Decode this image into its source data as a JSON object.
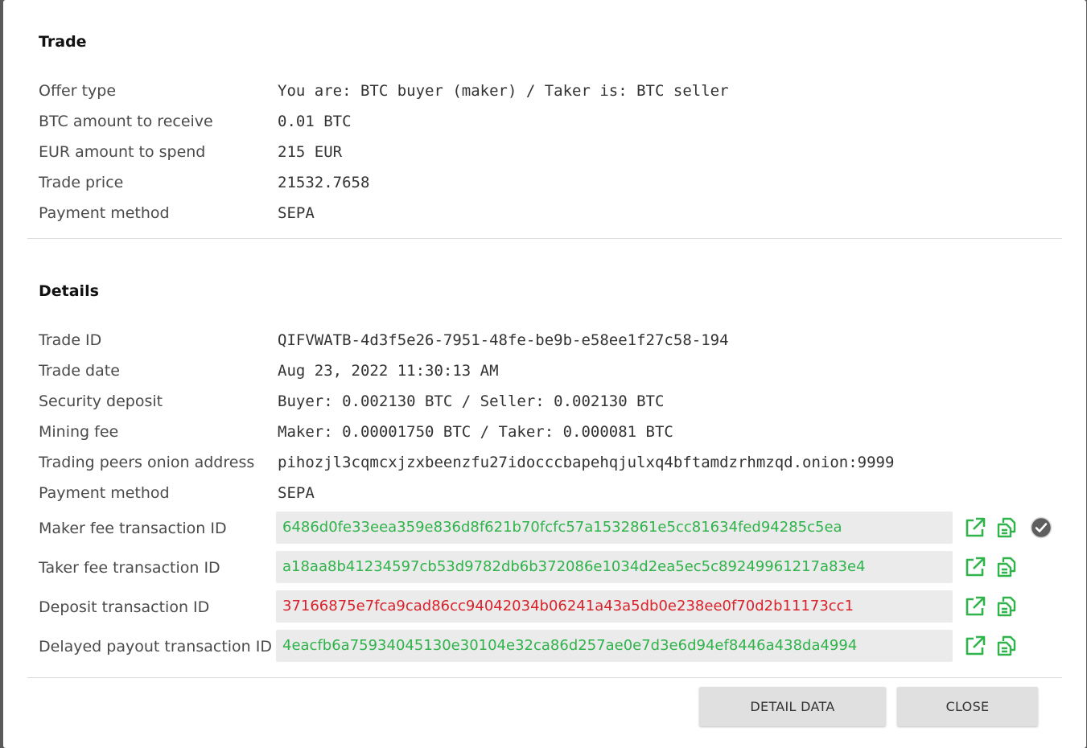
{
  "trade": {
    "title": "Trade",
    "rows": [
      {
        "label": "Offer type",
        "value": "You are: BTC buyer (maker) / Taker is: BTC seller"
      },
      {
        "label": "BTC amount to receive",
        "value": "0.01 BTC"
      },
      {
        "label": "EUR amount to spend",
        "value": "215 EUR"
      },
      {
        "label": "Trade price",
        "value": "21532.7658"
      },
      {
        "label": "Payment method",
        "value": "SEPA"
      }
    ]
  },
  "details": {
    "title": "Details",
    "rows": [
      {
        "label": "Trade ID",
        "value": "QIFVWATB-4d3f5e26-7951-48fe-be9b-e58ee1f27c58-194"
      },
      {
        "label": "Trade date",
        "value": "Aug 23, 2022 11:30:13 AM"
      },
      {
        "label": "Security deposit",
        "value": "Buyer: 0.002130 BTC / Seller: 0.002130 BTC"
      },
      {
        "label": "Mining fee",
        "value": "Maker: 0.00001750 BTC / Taker: 0.000081 BTC"
      },
      {
        "label": "Trading peers onion address",
        "value": "pihozjl3cqmcxjzxbeenzfu27idocccbapehqjulxq4bftamdzrhmzqd.onion:9999"
      },
      {
        "label": "Payment method",
        "value": "SEPA"
      }
    ],
    "transactions": [
      {
        "label": "Maker fee transaction ID",
        "value": "6486d0fe33eea359e836d8f621b70fcfc57a1532861e5cc81634fed94285c5ea",
        "color": "#2fb34a",
        "confirmed": true
      },
      {
        "label": "Taker fee transaction ID",
        "value": "a18aa8b41234597cb53d9782db6b372086e1034d2ea5ec5c89249961217a83e4",
        "color": "#2fb34a",
        "confirmed": false
      },
      {
        "label": "Deposit transaction ID",
        "value": "37166875e7fca9cad86cc94042034b06241a43a5db0e238ee0f70d2b11173cc1",
        "color": "#d9222a",
        "confirmed": false
      },
      {
        "label": "Delayed payout transaction ID",
        "value": "4eacfb6a75934045130e30104e32ca86d257ae0e7d3e6d94ef8446a438da4994",
        "color": "#2fb34a",
        "confirmed": false
      }
    ]
  },
  "icons": {
    "open": "external-link-icon",
    "copy": "copy-icon",
    "confirmed": "check-circle-icon",
    "accent": "#2fb34a"
  },
  "buttons": {
    "detail_data": "DETAIL DATA",
    "close": "CLOSE"
  }
}
